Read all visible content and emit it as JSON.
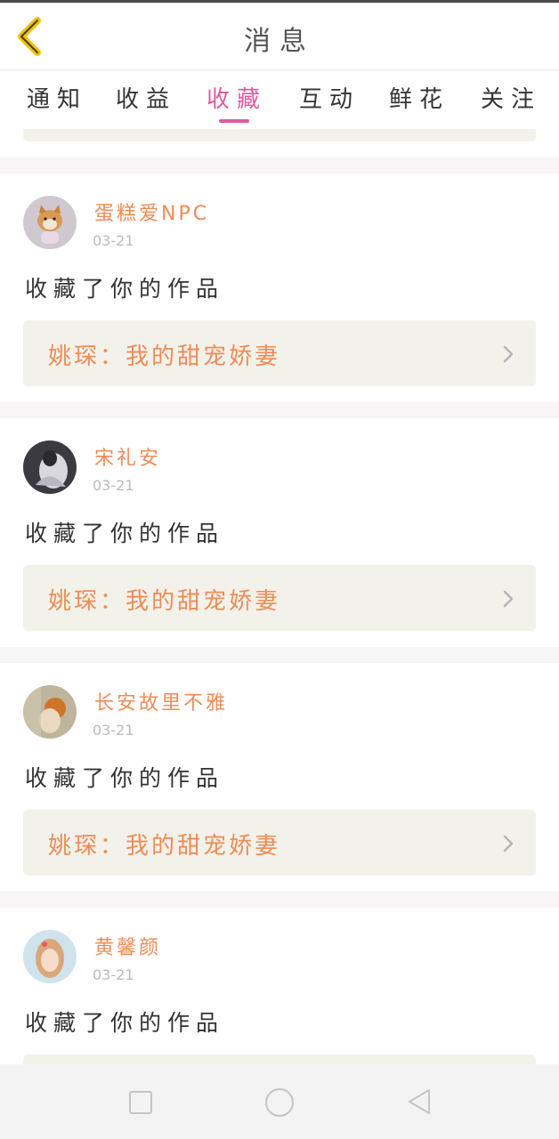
{
  "header": {
    "title": "消息"
  },
  "tabs": [
    {
      "label": "通知",
      "active": false
    },
    {
      "label": "收益",
      "active": false
    },
    {
      "label": "收藏",
      "active": true
    },
    {
      "label": "互动",
      "active": false
    },
    {
      "label": "鲜花",
      "active": false
    },
    {
      "label": "关注",
      "active": false
    }
  ],
  "messages": [
    {
      "username": "蛋糕爱NPC",
      "date": "03-21",
      "action": "收藏了你的作品",
      "work_title": "姚琛：我的甜宠娇妻"
    },
    {
      "username": "宋礼安",
      "date": "03-21",
      "action": "收藏了你的作品",
      "work_title": "姚琛：我的甜宠娇妻"
    },
    {
      "username": "长安故里不雅",
      "date": "03-21",
      "action": "收藏了你的作品",
      "work_title": "姚琛：我的甜宠娇妻"
    },
    {
      "username": "黄馨颜",
      "date": "03-21",
      "action": "收藏了你的作品",
      "work_title": ""
    }
  ],
  "colors": {
    "accent": "#e05aa1",
    "username": "#ef8b57",
    "work_card_bg": "#f3f2ea",
    "back_arrow": "#f2c400"
  }
}
